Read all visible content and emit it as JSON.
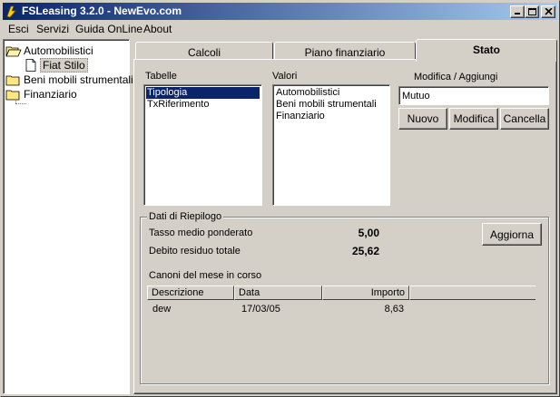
{
  "window": {
    "title": "FSLeasing 3.2.0 - NewEvo.com"
  },
  "menu": [
    "Esci",
    "Servizi",
    "Guida OnLine",
    "About"
  ],
  "tree": {
    "root1": "Automobilistici",
    "child1": "Fiat Stilo",
    "root2": "Beni mobili strumentali",
    "root3": "Finanziario"
  },
  "tabs": [
    "Calcoli",
    "Piano finanziario",
    "Stato"
  ],
  "stato": {
    "tabelle_label": "Tabelle",
    "tabelle": [
      "Tipologia",
      "TxRiferimento"
    ],
    "valori_label": "Valori",
    "valori": [
      "Automobilistici",
      "Beni mobili strumentali",
      "Finanziario"
    ],
    "modifica_label": "Modifica / Aggiungi",
    "input_value": "Mutuo",
    "buttons": {
      "nuovo": "Nuovo",
      "modifica": "Modifica",
      "cancella": "Cancella"
    }
  },
  "riepilogo": {
    "legend": "Dati di Riepilogo",
    "tasso_label": "Tasso medio ponderato",
    "tasso_value": "5,00",
    "debito_label": "Debito residuo totale",
    "debito_value": "25,62",
    "aggiorna": "Aggiorna",
    "canoni_label": "Canoni del mese in corso",
    "columns": [
      "Descrizione",
      "Data",
      "Importo"
    ],
    "rows": [
      {
        "descrizione": "dew",
        "data": "17/03/05",
        "importo": "8,63"
      }
    ]
  },
  "colors": {
    "titlebar_start": "#0a246a",
    "titlebar_end": "#a6caf0",
    "selection": "#0a246a",
    "face": "#d4d0c8"
  }
}
